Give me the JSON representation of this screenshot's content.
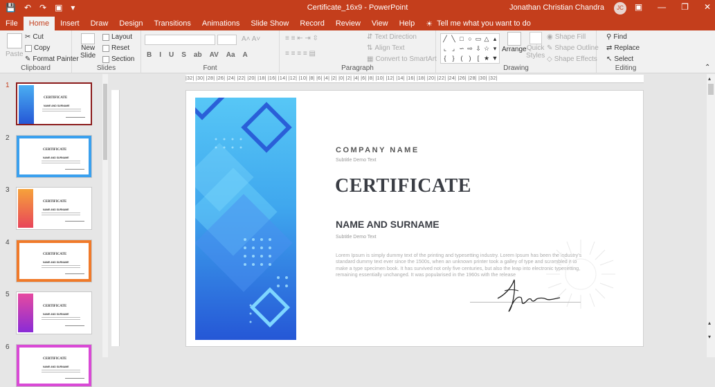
{
  "titlebar": {
    "title": "Certificate_16x9  -  PowerPoint",
    "user_name": "Jonathan Christian Chandra",
    "user_initials": "JC",
    "accent": "#c43e1c"
  },
  "tabs": [
    {
      "label": "File"
    },
    {
      "label": "Home"
    },
    {
      "label": "Insert"
    },
    {
      "label": "Draw"
    },
    {
      "label": "Design"
    },
    {
      "label": "Transitions"
    },
    {
      "label": "Animations"
    },
    {
      "label": "Slide Show"
    },
    {
      "label": "Record"
    },
    {
      "label": "Review"
    },
    {
      "label": "View"
    },
    {
      "label": "Help"
    }
  ],
  "tell_me": "Tell me what you want to do",
  "ribbon": {
    "clipboard": {
      "label": "Clipboard",
      "paste": "Paste",
      "cut": "Cut",
      "copy": "Copy",
      "format_painter": "Format Painter"
    },
    "slides": {
      "label": "Slides",
      "new_slide_1": "New",
      "new_slide_2": "Slide",
      "layout": "Layout",
      "reset": "Reset",
      "section": "Section"
    },
    "font": {
      "label": "Font",
      "format_buttons": [
        "B",
        "I",
        "U",
        "S",
        "ab",
        "AV",
        "Aa",
        "A"
      ]
    },
    "paragraph": {
      "label": "Paragraph",
      "text_direction": "Text Direction",
      "align_text": "Align Text",
      "smartart": "Convert to SmartArt"
    },
    "drawing": {
      "label": "Drawing",
      "arrange": "Arrange",
      "quick_styles_1": "Quick",
      "quick_styles_2": "Styles",
      "shape_fill": "Shape Fill",
      "shape_outline": "Shape Outline",
      "shape_effects": "Shape Effects"
    },
    "editing": {
      "label": "Editing",
      "find": "Find",
      "replace": "Replace",
      "select": "Select"
    }
  },
  "ruler_text": "16 ·15 ·14 ·13 ·12 ·11 ·10 ·9 ·8 ·7 ·6 ·5 ·4 ·3 ·2 ·1 ·0 ·1 ·2 ·3 ·4 ·5 ·6 ·7 ·8 ·9 ·10 ·11 ·12 ·13 ·14 ·15 ·16",
  "ruler_text_display": "|32| |30| |28| |26| |24| |22| |20| |18| |16| |14| |12| |10| |8| |6| |4| |2| |0| |2| |4| |6| |8| |10| |12| |14| |16| |18| |20| |22| |24| |26| |28| |30| |32|",
  "thumbnails": [
    {
      "number": "1",
      "color_top": "#4aaef2",
      "color_bottom": "#2557d6",
      "frame": "side",
      "selected": true
    },
    {
      "number": "2",
      "color_top": "#3aa0ee",
      "color_bottom": "#2a6adf",
      "frame": "border",
      "selected": false
    },
    {
      "number": "3",
      "color_top": "#f6a23a",
      "color_bottom": "#e8455a",
      "frame": "side",
      "selected": false
    },
    {
      "number": "4",
      "color_top": "#f07a2a",
      "color_bottom": "#e0501c",
      "frame": "border",
      "selected": false
    },
    {
      "number": "5",
      "color_top": "#e64aa0",
      "color_bottom": "#8a2bd6",
      "frame": "side",
      "selected": false
    },
    {
      "number": "6",
      "color_top": "#d94ad6",
      "color_bottom": "#8a2bd6",
      "frame": "border",
      "selected": false
    }
  ],
  "thumb_text": {
    "company": "COMPANY NAME",
    "title": "CERTIFICATE",
    "name": "NAME AND SURNAME"
  },
  "slide": {
    "company": "COMPANY NAME",
    "subtitle1": "Subtitle Demo Text",
    "certificate": "CERTIFICATE",
    "name": "NAME AND SURNAME",
    "subtitle2": "Subtitle Demo Text",
    "lorem": "Lorem Ipsum is simply dummy text of the printing and typesetting industry. Lorem Ipsum has been the industry's standard dummy text ever since the 1500s, when an unknown printer took a galley of type and scrambled it to make a type specimen book. It has survived not only five centuries, but also the leap into electronic typesetting, remaining essentially unchanged. It was popularised in the 1960s with the release"
  }
}
